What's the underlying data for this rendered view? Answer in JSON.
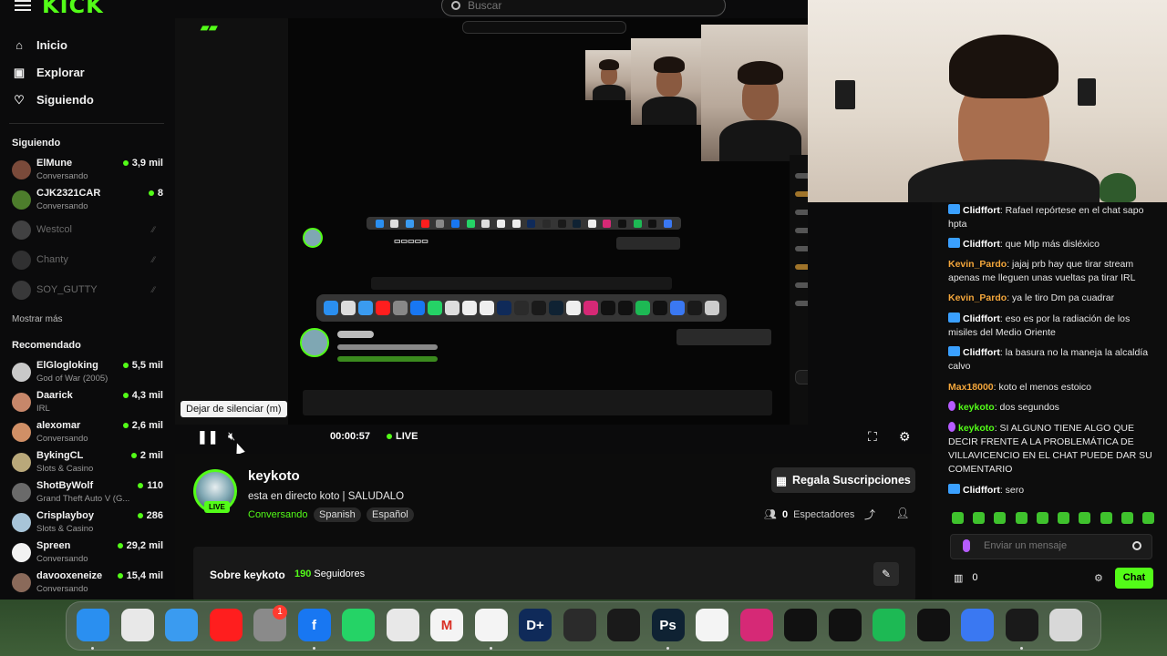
{
  "logo": "KICK",
  "search": {
    "placeholder": "Buscar"
  },
  "nav": [
    {
      "label": "Inicio",
      "icon": "home-icon"
    },
    {
      "label": "Explorar",
      "icon": "compass-icon"
    },
    {
      "label": "Siguiendo",
      "icon": "heart-icon"
    }
  ],
  "following": {
    "title": "Siguiendo",
    "channels": [
      {
        "name": "ElMune",
        "game": "Conversando",
        "viewers": "3,9 mil",
        "color": "#7a4a3a"
      },
      {
        "name": "CJK2321CAR",
        "game": "Conversando",
        "viewers": "8",
        "color": "#4d7d2c"
      },
      {
        "name": "Westcol",
        "game": "",
        "viewers": "",
        "color": "#777777"
      },
      {
        "name": "Chanty",
        "game": "",
        "viewers": "",
        "color": "#555555"
      },
      {
        "name": "SOY_GUTTY",
        "game": "",
        "viewers": "",
        "color": "#666666"
      }
    ],
    "more": "Mostrar más"
  },
  "recommended": {
    "title": "Recomendado",
    "channels": [
      {
        "name": "ElGlogloking",
        "game": "God of War (2005)",
        "viewers": "5,5 mil",
        "color": "#c9c9c9"
      },
      {
        "name": "Daarick",
        "game": "IRL",
        "viewers": "4,3 mil",
        "color": "#c7876a"
      },
      {
        "name": "alexomar",
        "game": "Conversando",
        "viewers": "2,6 mil",
        "color": "#d08f66"
      },
      {
        "name": "BykingCL",
        "game": "Slots & Casino",
        "viewers": "2 mil",
        "color": "#b9a87a"
      },
      {
        "name": "ShotByWolf",
        "game": "Grand Theft Auto V (G...",
        "viewers": "110",
        "color": "#6a6a6a"
      },
      {
        "name": "Crisplayboy",
        "game": "Slots & Casino",
        "viewers": "286",
        "color": "#a7c4d8"
      },
      {
        "name": "Spreen",
        "game": "Conversando",
        "viewers": "29,2 mil",
        "color": "#f2f2f2"
      },
      {
        "name": "davooxeneize",
        "game": "Conversando",
        "viewers": "15,4 mil",
        "color": "#8a6a5a"
      }
    ]
  },
  "player": {
    "tooltip": "Dejar de silenciar (m)",
    "time": "00:00:57",
    "live": "LIVE"
  },
  "stream": {
    "name": "keykoto",
    "title": "esta en directo koto | SALUDALO",
    "category": "Conversando",
    "tags": [
      "Spanish",
      "Español"
    ],
    "live_badge": "LIVE",
    "gift_label": "Regala Suscripciones",
    "viewers_count": "0",
    "viewers_label": "Espectadores",
    "about_title": "Sobre keykoto",
    "followers_count": "190",
    "followers_label": "Seguidores"
  },
  "chat": {
    "messages": [
      {
        "user": "Clidffort",
        "badge": "bot",
        "color": "#ffffff",
        "text": "Rafael repórtese en el chat sapo hpta"
      },
      {
        "user": "Clidffort",
        "badge": "bot",
        "color": "#ffffff",
        "text": "que Mlp más disléxico"
      },
      {
        "user": "Kevin_Pardo",
        "badge": "",
        "color": "#f3a63b",
        "text": "jajaj prb hay que tirar stream apenas me lleguen unas vueltas pa tirar IRL"
      },
      {
        "user": "Kevin_Pardo",
        "badge": "",
        "color": "#f3a63b",
        "text": "ya le tiro Dm pa cuadrar"
      },
      {
        "user": "Clidffort",
        "badge": "bot",
        "color": "#ffffff",
        "text": "eso es por la radiación de los misiles del Medio Oriente"
      },
      {
        "user": "Clidffort",
        "badge": "bot",
        "color": "#ffffff",
        "text": "la basura no la maneja la alcaldía calvo"
      },
      {
        "user": "Max18000",
        "badge": "",
        "color": "#f3a63b",
        "text": "koto el menos estoico"
      },
      {
        "user": "keykoto",
        "badge": "mic",
        "color": "#53fc18",
        "text": "dos segundos"
      },
      {
        "user": "keykoto",
        "badge": "mic",
        "color": "#53fc18",
        "text": "SI ALGUNO TIENE ALGO QUE DECIR FRENTE A LA PROBLEMÁTICA DE VILLAVICENCIO EN EL CHAT PUEDE DAR SU COMENTARIO"
      },
      {
        "user": "Clidffort",
        "badge": "bot",
        "color": "#ffffff",
        "text": "sero"
      }
    ],
    "input_placeholder": "Enviar un mensaje",
    "count": "0",
    "send_label": "Chat"
  },
  "dock": {
    "apps": [
      {
        "name": "finder-icon",
        "label": "",
        "color": "#2a8ff0"
      },
      {
        "name": "launchpad-icon",
        "label": "",
        "color": "#e8e8e8"
      },
      {
        "name": "safari-icon",
        "label": "",
        "color": "#3a9bf0"
      },
      {
        "name": "youtube-icon",
        "label": "",
        "color": "#ff1e1e"
      },
      {
        "name": "settings-icon",
        "label": "",
        "color": "#8a8a8a"
      },
      {
        "name": "facebook-icon",
        "label": "f",
        "color": "#1877f2"
      },
      {
        "name": "whatsapp-icon",
        "label": "",
        "color": "#25d366"
      },
      {
        "name": "chrome-icon",
        "label": "",
        "color": "#e8e8e8"
      },
      {
        "name": "gmail-icon",
        "label": "M",
        "color": "#f4f4f4"
      },
      {
        "name": "photos-icon",
        "label": "",
        "color": "#f4f4f4"
      },
      {
        "name": "disneyplus-icon",
        "label": "D+",
        "color": "#0f2a59"
      },
      {
        "name": "davinci-icon",
        "label": "",
        "color": "#2b2b2b"
      },
      {
        "name": "obs-icon",
        "label": "",
        "color": "#1a1a1a"
      },
      {
        "name": "photoshop-icon",
        "label": "Ps",
        "color": "#0f2233"
      },
      {
        "name": "capcut-icon",
        "label": "",
        "color": "#f4f4f4"
      },
      {
        "name": "instagram-icon",
        "label": "",
        "color": "#d62976"
      },
      {
        "name": "camera-icon",
        "label": "",
        "color": "#111111"
      },
      {
        "name": "chatgpt-icon",
        "label": "",
        "color": "#111111"
      },
      {
        "name": "spotify-icon",
        "label": "",
        "color": "#1db954"
      },
      {
        "name": "tiktok-icon",
        "label": "",
        "color": "#111111"
      },
      {
        "name": "roblox-icon",
        "label": "",
        "color": "#3a78f2"
      },
      {
        "name": "obs-recording-icon",
        "label": "",
        "color": "#1a1a1a"
      },
      {
        "name": "trash-icon",
        "label": "",
        "color": "#d8d8d8"
      }
    ],
    "settings_badge": "1"
  }
}
